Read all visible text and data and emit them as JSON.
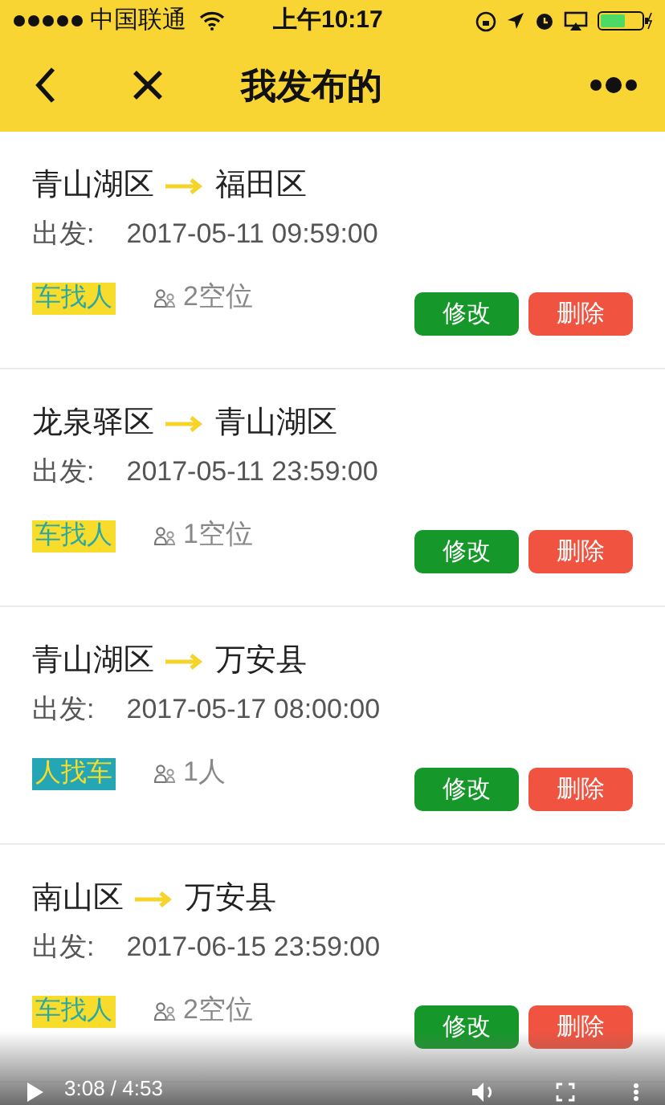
{
  "status_bar": {
    "carrier": "中国联通",
    "time": "上午10:17"
  },
  "nav": {
    "title": "我发布的"
  },
  "trips": [
    {
      "from": "青山湖区",
      "to": "福田区",
      "depart_label": "出发:",
      "depart_time": "2017-05-11 09:59:00",
      "tag": {
        "kind": "car",
        "label": "车找人"
      },
      "seats": "2空位",
      "edit": "修改",
      "delete": "删除"
    },
    {
      "from": "龙泉驿区",
      "to": "青山湖区",
      "depart_label": "出发:",
      "depart_time": "2017-05-11 23:59:00",
      "tag": {
        "kind": "car",
        "label": "车找人"
      },
      "seats": "1空位",
      "edit": "修改",
      "delete": "删除"
    },
    {
      "from": "青山湖区",
      "to": "万安县",
      "depart_label": "出发:",
      "depart_time": "2017-05-17 08:00:00",
      "tag": {
        "kind": "person",
        "label": "人找车"
      },
      "seats": "1人",
      "edit": "修改",
      "delete": "删除"
    },
    {
      "from": "南山区",
      "to": "万安县",
      "depart_label": "出发:",
      "depart_time": "2017-06-15 23:59:00",
      "tag": {
        "kind": "car",
        "label": "车找人"
      },
      "seats": "2空位",
      "edit": "修改",
      "delete": "删除"
    }
  ],
  "video_bar": {
    "time": "3:08 / 4:53"
  }
}
